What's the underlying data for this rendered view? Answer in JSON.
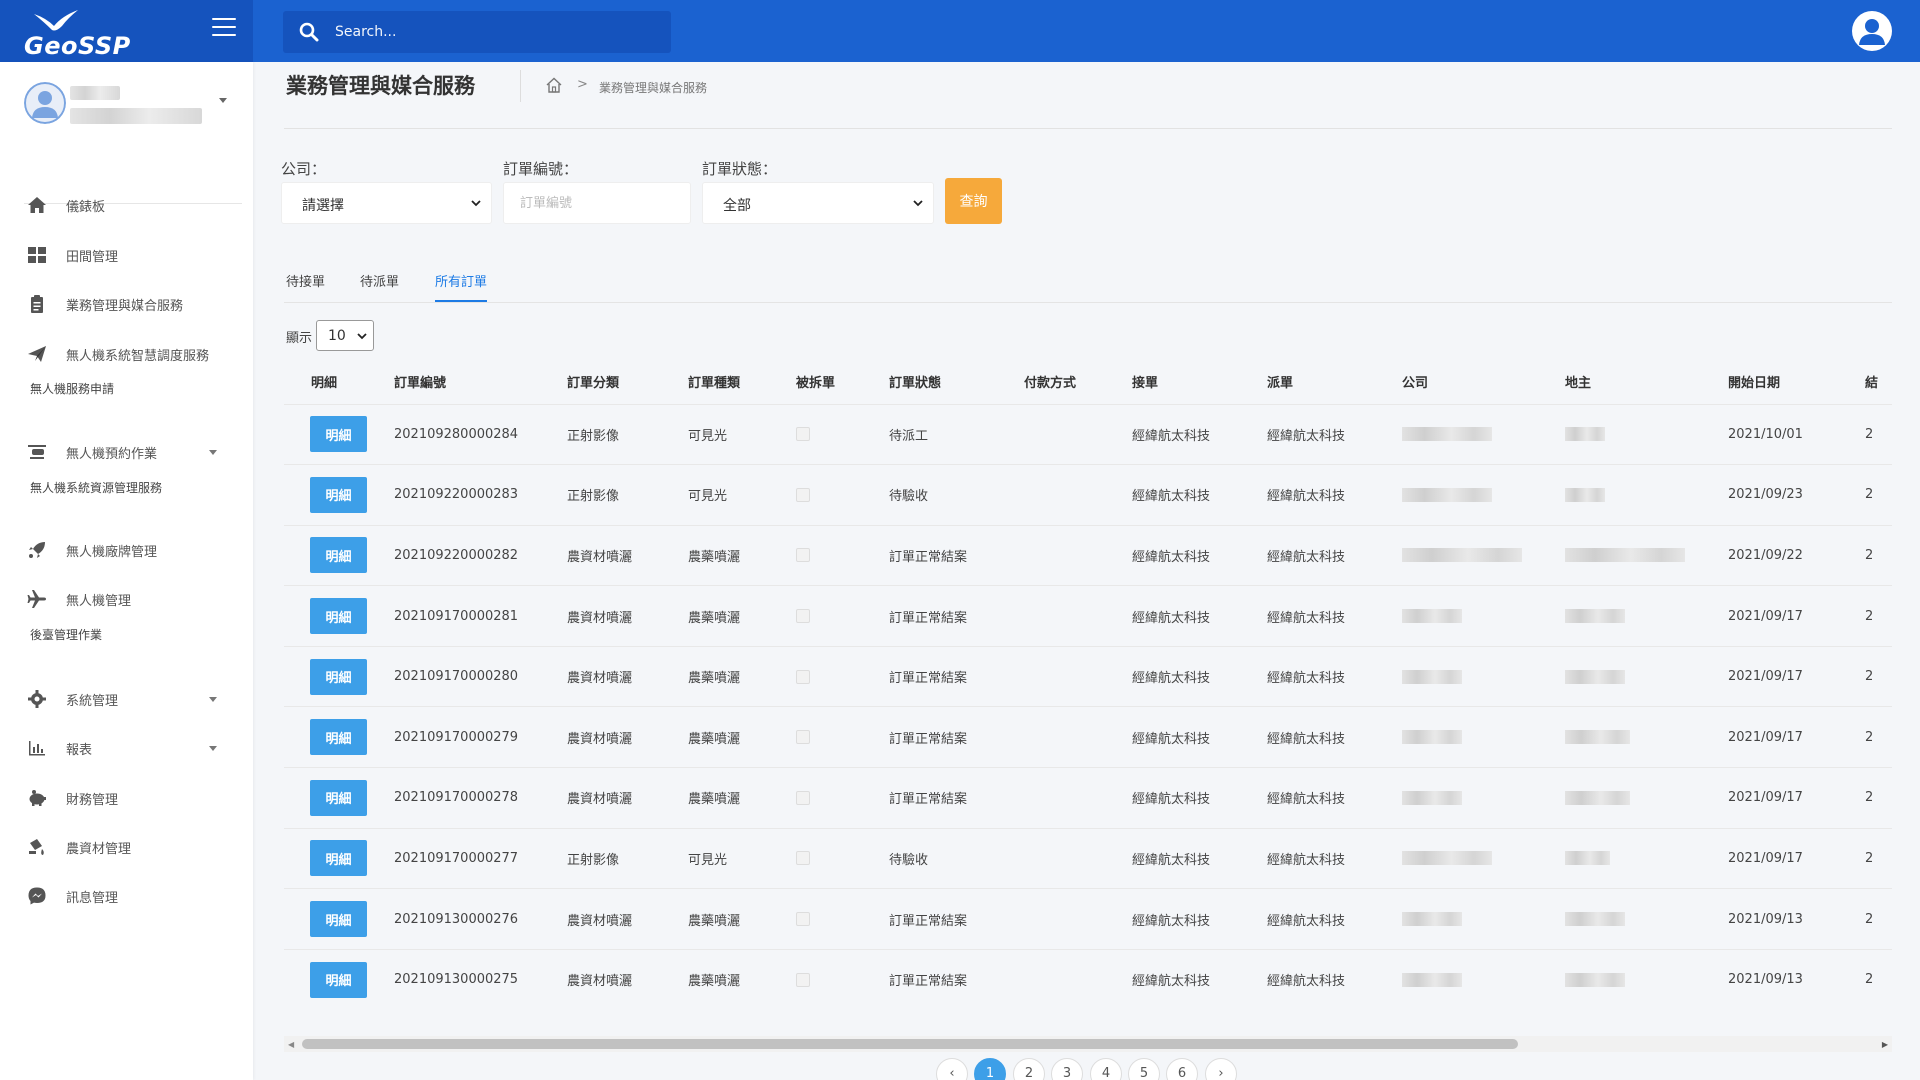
{
  "app": {
    "logo_text": "GeoSSP"
  },
  "search": {
    "placeholder": "Search..."
  },
  "sidebar": {
    "items": [
      {
        "label": "儀錶板",
        "icon": "home-icon"
      },
      {
        "label": "田間管理",
        "icon": "grid-icon"
      },
      {
        "label": "業務管理與媒合服務",
        "icon": "clipboard-icon"
      },
      {
        "label": "無人機系統智慧調度服務",
        "icon": "paper-plane-icon"
      },
      {
        "label": "無人機預約作業",
        "icon": "drone-icon"
      },
      {
        "label": "無人機廠牌管理",
        "icon": "rocket-icon"
      },
      {
        "label": "無人機管理",
        "icon": "plane-icon"
      },
      {
        "label": "系統管理",
        "icon": "gear-icon"
      },
      {
        "label": "報表",
        "icon": "bar-chart-icon"
      },
      {
        "label": "財務管理",
        "icon": "piggy-bank-icon"
      },
      {
        "label": "農資材管理",
        "icon": "spray-icon"
      },
      {
        "label": "訊息管理",
        "icon": "messenger-icon"
      }
    ],
    "sections": [
      "無人機服務申請",
      "無人機系統資源管理服務",
      "後臺管理作業"
    ]
  },
  "page": {
    "title": "業務管理與媒合服務",
    "breadcrumb_current": "業務管理與媒合服務"
  },
  "filters": {
    "company_label": "公司：",
    "company_value": "請選擇",
    "order_no_label": "訂單編號：",
    "order_no_placeholder": "訂單編號",
    "status_label": "訂單狀態：",
    "status_value": "全部",
    "query_button": "查詢"
  },
  "tabs": [
    {
      "label": "待接單"
    },
    {
      "label": "待派單"
    },
    {
      "label": "所有訂單"
    }
  ],
  "page_size": {
    "label": "顯示",
    "value": "10"
  },
  "table": {
    "headers": [
      "明細",
      "訂單編號",
      "訂單分類",
      "訂單種類",
      "被拆單",
      "訂單狀態",
      "付款方式",
      "接單",
      "派單",
      "公司",
      "地主",
      "開始日期",
      "結"
    ],
    "detail_label": "明細",
    "rows": [
      {
        "order_no": "202109280000284",
        "category": "正射影像",
        "type": "可見光",
        "status": "待派工",
        "receiver": "經緯航太科技",
        "dispatcher": "經緯航太科技",
        "start": "2021/10/01",
        "end": "2"
      },
      {
        "order_no": "202109220000283",
        "category": "正射影像",
        "type": "可見光",
        "status": "待驗收",
        "receiver": "經緯航太科技",
        "dispatcher": "經緯航太科技",
        "start": "2021/09/23",
        "end": "2"
      },
      {
        "order_no": "202109220000282",
        "category": "農資材噴灑",
        "type": "農藥噴灑",
        "status": "訂單正常結案",
        "receiver": "經緯航太科技",
        "dispatcher": "經緯航太科技",
        "start": "2021/09/22",
        "end": "2"
      },
      {
        "order_no": "202109170000281",
        "category": "農資材噴灑",
        "type": "農藥噴灑",
        "status": "訂單正常結案",
        "receiver": "經緯航太科技",
        "dispatcher": "經緯航太科技",
        "start": "2021/09/17",
        "end": "2"
      },
      {
        "order_no": "202109170000280",
        "category": "農資材噴灑",
        "type": "農藥噴灑",
        "status": "訂單正常結案",
        "receiver": "經緯航太科技",
        "dispatcher": "經緯航太科技",
        "start": "2021/09/17",
        "end": "2"
      },
      {
        "order_no": "202109170000279",
        "category": "農資材噴灑",
        "type": "農藥噴灑",
        "status": "訂單正常結案",
        "receiver": "經緯航太科技",
        "dispatcher": "經緯航太科技",
        "start": "2021/09/17",
        "end": "2"
      },
      {
        "order_no": "202109170000278",
        "category": "農資材噴灑",
        "type": "農藥噴灑",
        "status": "訂單正常結案",
        "receiver": "經緯航太科技",
        "dispatcher": "經緯航太科技",
        "start": "2021/09/17",
        "end": "2"
      },
      {
        "order_no": "202109170000277",
        "category": "正射影像",
        "type": "可見光",
        "status": "待驗收",
        "receiver": "經緯航太科技",
        "dispatcher": "經緯航太科技",
        "start": "2021/09/17",
        "end": "2"
      },
      {
        "order_no": "202109130000276",
        "category": "農資材噴灑",
        "type": "農藥噴灑",
        "status": "訂單正常結案",
        "receiver": "經緯航太科技",
        "dispatcher": "經緯航太科技",
        "start": "2021/09/13",
        "end": "2"
      },
      {
        "order_no": "202109130000275",
        "category": "農資材噴灑",
        "type": "農藥噴灑",
        "status": "訂單正常結案",
        "receiver": "經緯航太科技",
        "dispatcher": "經緯航太科技",
        "start": "2021/09/13",
        "end": "2"
      }
    ]
  },
  "pagination": {
    "prev": "‹",
    "next": "›",
    "pages": [
      "1",
      "2",
      "3",
      "4",
      "5",
      "6"
    ],
    "active": "1"
  },
  "colors": {
    "topbar": "#1b62d0",
    "accent": "#3d9fe8",
    "query": "#f6a93b",
    "tab_active": "#1d7be5"
  }
}
